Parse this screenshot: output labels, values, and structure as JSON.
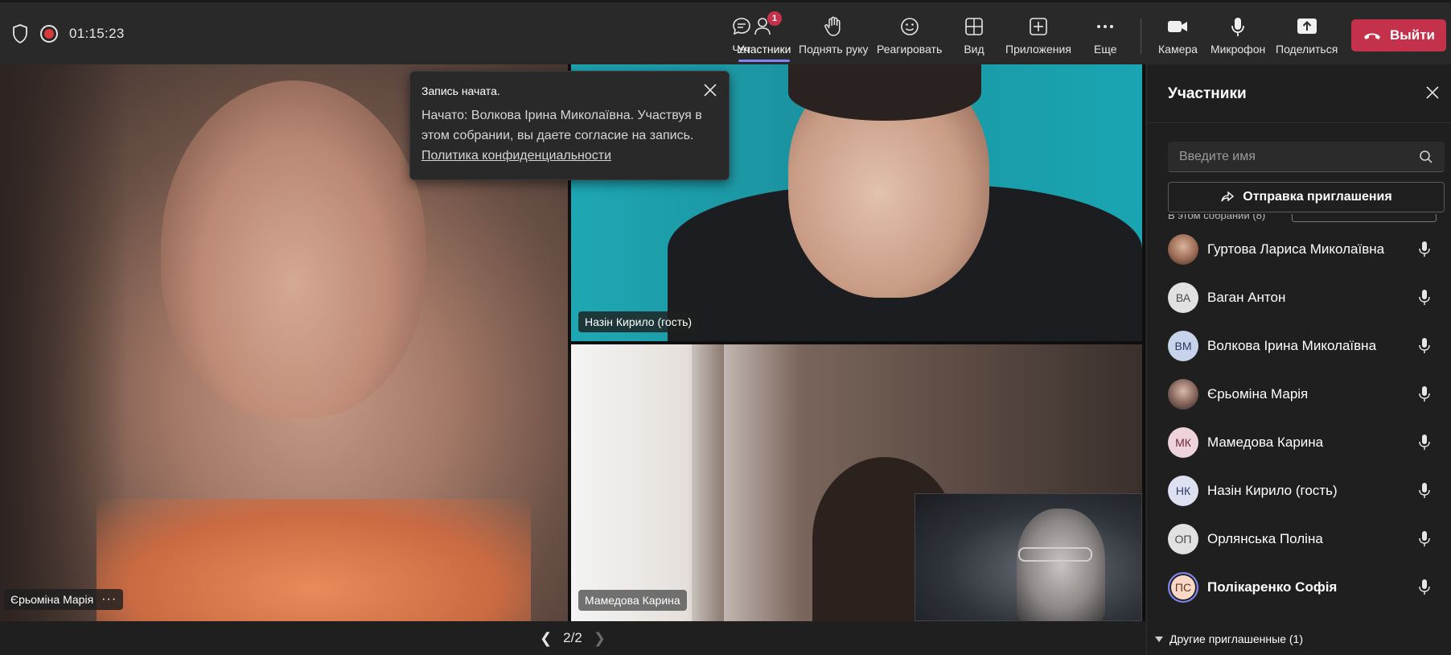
{
  "topbar": {
    "timer": "01:15:23",
    "buttons": {
      "chat": "Чат",
      "participants": "Участники",
      "raise_hand": "Поднять руку",
      "react": "Реагировать",
      "view": "Вид",
      "apps": "Приложения",
      "more": "Еще",
      "camera": "Камера",
      "mic": "Микрофон",
      "share": "Поделиться"
    },
    "participants_badge": "1",
    "leave": "Выйти"
  },
  "toast": {
    "title": "Запись начата.",
    "body": "Начато: Волкова Ірина Миколаївна. Участвуя в этом собрании, вы даете согласие на запись.",
    "link": "Политика конфиденциальности"
  },
  "tiles": {
    "t1_name": "Єрьоміна Марія",
    "t2_name": "Назін Кирило (гость)",
    "t3_name": "Мамедова Карина"
  },
  "pager": {
    "label": "2/2"
  },
  "panel": {
    "title": "Участники",
    "search_placeholder": "Введите имя",
    "invite": "Отправка приглашения",
    "peek_text": "В этом собрании (8)",
    "participants": [
      {
        "initials": "",
        "name": "Гуртова Лариса Миколаївна"
      },
      {
        "initials": "ВА",
        "name": "Ваган Антон"
      },
      {
        "initials": "ВМ",
        "name": "Волкова Ірина Миколаївна"
      },
      {
        "initials": "",
        "name": "Єрьоміна Марія"
      },
      {
        "initials": "МК",
        "name": "Мамедова Карина"
      },
      {
        "initials": "НК",
        "name": "Назін Кирило (гость)"
      },
      {
        "initials": "ОП",
        "name": "Орлянська Поліна"
      },
      {
        "initials": "ПС",
        "name": "Полікаренко Софія"
      }
    ],
    "other_invited": "Другие приглашенные (1)"
  },
  "colors": {
    "accent": "#7f85f5",
    "leave": "#c4314b",
    "recording": "#d83b3b"
  }
}
